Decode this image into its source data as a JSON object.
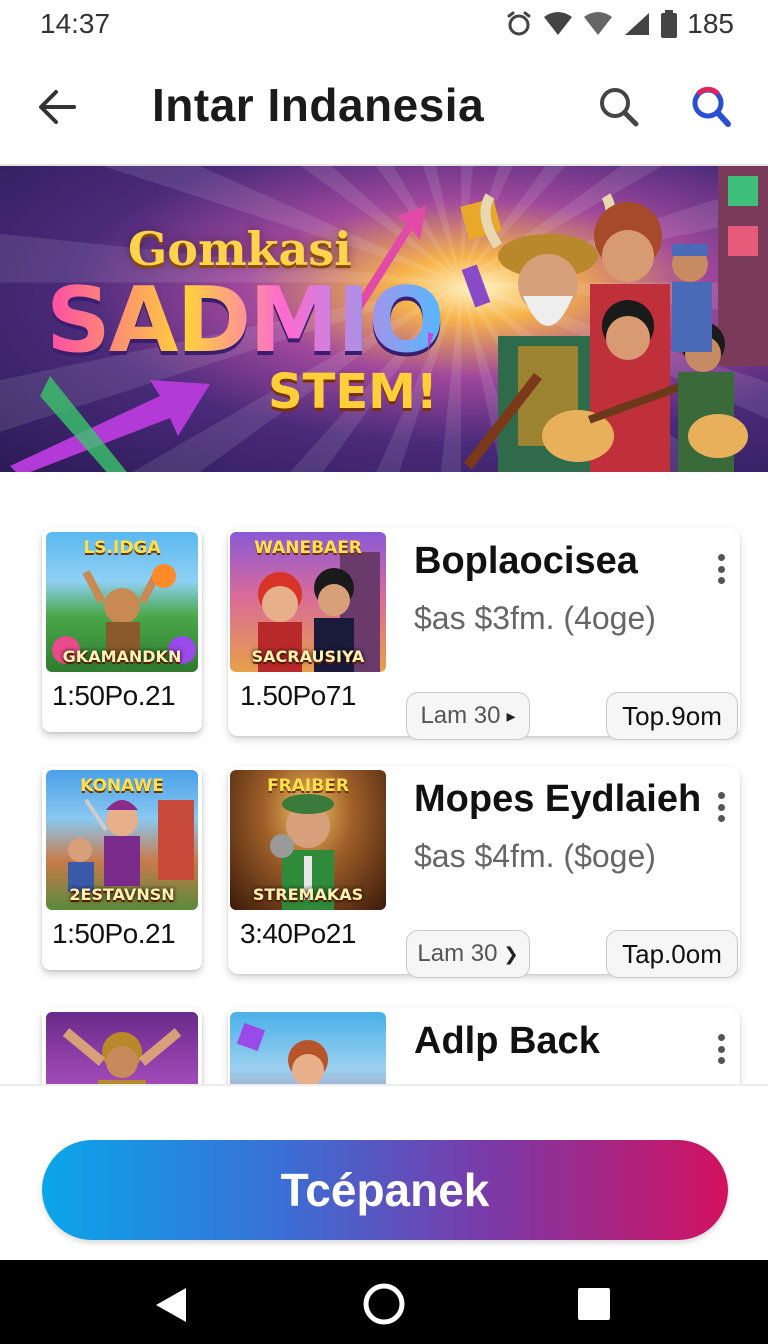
{
  "status_bar": {
    "time": "14:37",
    "battery": "185",
    "icons": [
      "alarm-icon",
      "wifi-icon",
      "signal-icon",
      "battery-icon"
    ]
  },
  "app_bar": {
    "title": "Intar Indanesia",
    "back_icon": "arrow-left-icon",
    "search_icon": "search-icon",
    "search_icon_2": "search-colored-icon"
  },
  "banner": {
    "line1": "Gomkasi",
    "line2": "SADMIO",
    "line3": "STEM!"
  },
  "items": [
    {
      "thumb_left": {
        "title": "LS.IDGA",
        "sub": "GKAMANDKN",
        "caption": "1:50Po.21"
      },
      "thumb_right": {
        "title": "WANEBAER",
        "sub": "SACRAUSIYA",
        "caption": "1.50Po71"
      },
      "title": "Boplaocisea",
      "price": "$as  $3fm. (4oge)",
      "lam_label": "Lam 30",
      "top_label": "Top.9om"
    },
    {
      "thumb_left": {
        "title": "KONAWE",
        "sub": "2ESTAVNSN",
        "caption": "1:50Po.21"
      },
      "thumb_right": {
        "title": "FRAIBER",
        "sub": "STREMAKAS",
        "caption": "3:40Po21"
      },
      "title": "Mopes Eydlaieh",
      "price": "$as  $4fm. ($oge)",
      "lam_label": "Lam 30",
      "top_label": "Tap.0om"
    },
    {
      "thumb_left": {
        "title": "",
        "sub": "",
        "caption": ""
      },
      "thumb_right": {
        "title": "",
        "sub": "",
        "caption": ""
      },
      "title": "Adlp Back",
      "price": "",
      "lam_label": "",
      "top_label": ""
    }
  ],
  "cta": {
    "label": "Tcépanek"
  },
  "colors": {
    "cta_start": "#0aa6ea",
    "cta_end": "#d3115f",
    "search_accent": "#2a4fd6"
  }
}
